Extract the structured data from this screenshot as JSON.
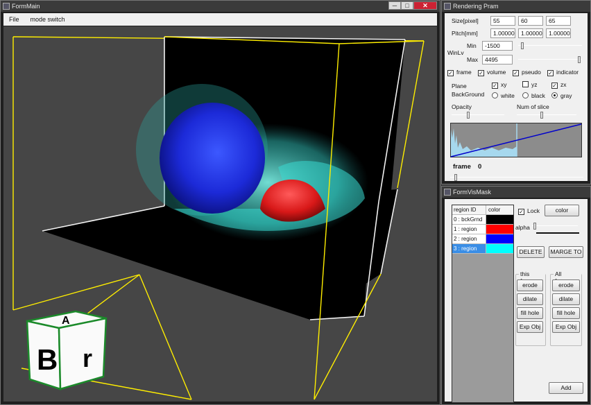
{
  "main_window": {
    "title": "FormMain",
    "menu": [
      "File",
      "mode switch"
    ],
    "controls": {
      "min": "─",
      "max": "□",
      "close": "✕"
    }
  },
  "orientation_cube": {
    "front_letter": "B",
    "top_letter": "A",
    "side_letter": "r"
  },
  "rendering": {
    "title": "Rendering Pram",
    "size_label": "Size[pixel]",
    "size_values": [
      "55",
      "60",
      "65"
    ],
    "pitch_label": "Pitch[mm]",
    "pitch_values": [
      "1.00000",
      "1.00000",
      "1.00000"
    ],
    "winlv_label": "WinLv",
    "min_label": "Min",
    "min_value": "-1500",
    "max_label": "Max",
    "max_value": "4495",
    "checkboxes": [
      {
        "label": "frame",
        "checked": true
      },
      {
        "label": "volume",
        "checked": true
      },
      {
        "label": "pseudo",
        "checked": true
      },
      {
        "label": "indicator",
        "checked": true
      }
    ],
    "plane_label": "Plane",
    "planes": [
      {
        "label": "xy",
        "checked": true
      },
      {
        "label": "yz",
        "checked": false
      },
      {
        "label": "zx",
        "checked": true
      }
    ],
    "background_label": "BackGround",
    "backgrounds": [
      {
        "label": "white",
        "selected": false
      },
      {
        "label": "black",
        "selected": false
      },
      {
        "label": "gray",
        "selected": true
      }
    ],
    "opacity_label": "Opacity",
    "num_slice_label": "Num of slice",
    "frame_label": "frame",
    "frame_value": "0"
  },
  "vismask": {
    "title": "FormVisMask",
    "columns": [
      "region ID",
      "color"
    ],
    "regions": [
      {
        "label": "0 : bckGrnd",
        "color": "#000000",
        "selected": false
      },
      {
        "label": "1 : region",
        "color": "#ff0000",
        "selected": false
      },
      {
        "label": "2 : region",
        "color": "#0000ff",
        "selected": false
      },
      {
        "label": "3 : region",
        "color": "#00ffff",
        "selected": true
      }
    ],
    "lock_label": "Lock",
    "lock_checked": true,
    "color_button": "color",
    "alpha_label": "alpha",
    "delete_button": "DELETE",
    "marge_button": "MARGE TO",
    "this_frame_label": "this frame",
    "all_frames_label": "All frames",
    "this_frame_buttons": [
      "erode",
      "dilate",
      "fill hole",
      "Exp Obj"
    ],
    "all_frames_buttons": [
      "erode",
      "dilate",
      "fill hole",
      "Exp Obj"
    ],
    "add_button": "Add"
  },
  "colors": {
    "frame_edge": "#ffee00",
    "volume_blue": "#1f2fe0",
    "volume_red": "#e01818",
    "volume_cyan": "#40e0d0",
    "histogram_line": "#0000cc"
  }
}
